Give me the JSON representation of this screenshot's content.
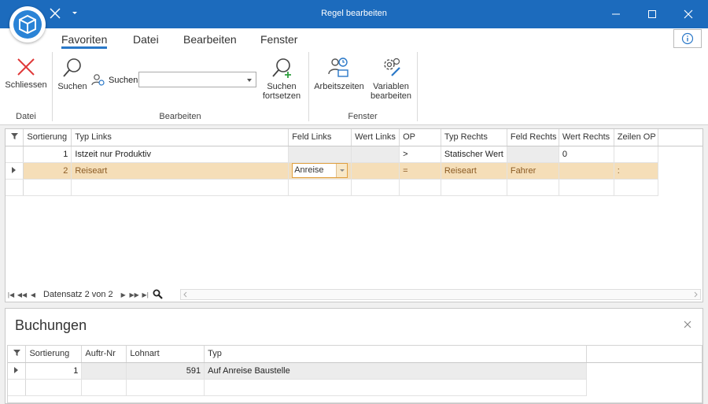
{
  "window": {
    "title": "Regel bearbeiten",
    "accent_color": "#1c6bbd",
    "icons": [
      "app-logo-cube",
      "close-icon",
      "dropdown-icon",
      "minimize-icon",
      "maximize-icon",
      "close-icon"
    ]
  },
  "tabs": [
    {
      "label": "Favoriten",
      "active": true
    },
    {
      "label": "Datei"
    },
    {
      "label": "Bearbeiten"
    },
    {
      "label": "Fenster"
    }
  ],
  "ribbon": {
    "schliessen": "Schliessen",
    "suchen": "Suchen",
    "suchen_inline": "Suchen",
    "search_value": "",
    "suchen_fortsetzen_1": "Suchen",
    "suchen_fortsetzen_2": "fortsetzen",
    "arbeitszeiten": "Arbeitszeiten",
    "variablen_1": "Variablen",
    "variablen_2": "bearbeiten",
    "groups": {
      "datei": "Datei",
      "bearbeiten": "Bearbeiten",
      "fenster": "Fenster"
    }
  },
  "main_grid": {
    "columns": [
      "Sortierung",
      "Typ Links",
      "Feld Links",
      "Wert Links",
      "OP",
      "Typ Rechts",
      "Feld Rechts",
      "Wert Rechts",
      "Zeilen OP"
    ],
    "rows": [
      {
        "sortierung": "1",
        "typ_links": "Istzeit nur Produktiv",
        "feld_links": "",
        "wert_links": "",
        "op": ">",
        "typ_rechts": "Statischer Wert",
        "feld_rechts": "",
        "wert_rechts": "0",
        "zeilen_op": ""
      },
      {
        "sortierung": "2",
        "typ_links": "Reiseart",
        "feld_links": "Anreise",
        "wert_links": "",
        "op": "=",
        "typ_rechts": "Reiseart",
        "feld_rechts": "Fahrer",
        "wert_rechts": "",
        "zeilen_op": ":"
      }
    ],
    "navigator": {
      "record_text": "Datensatz 2 von 2"
    }
  },
  "buchungen": {
    "title": "Buchungen",
    "columns": [
      "Sortierung",
      "Auftr-Nr",
      "Lohnart",
      "Typ"
    ],
    "rows": [
      {
        "sortierung": "1",
        "auftr_nr": "",
        "lohnart": "591",
        "typ": "Auf Anreise Baustelle"
      }
    ]
  }
}
